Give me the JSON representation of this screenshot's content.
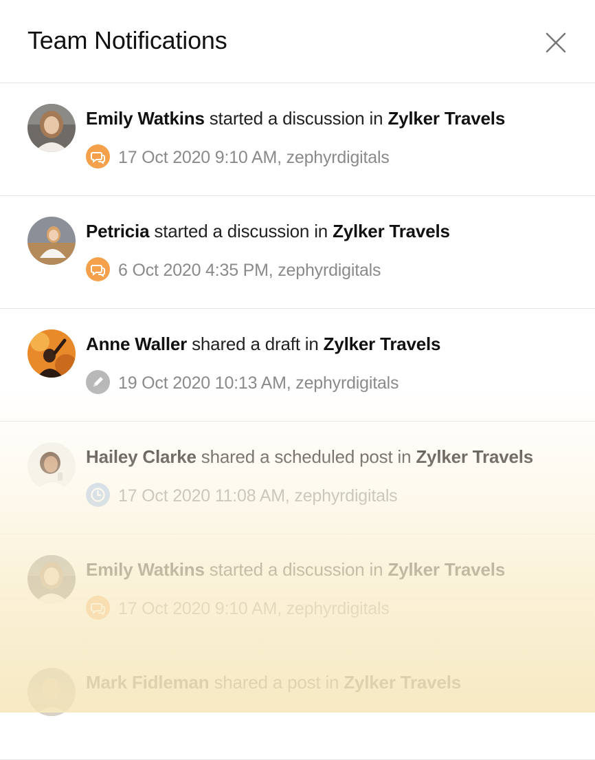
{
  "panel": {
    "title": "Team Notifications",
    "close_icon": "close-icon"
  },
  "notifications": [
    {
      "name": "Emily Watkins",
      "action": "started a discussion in",
      "target": "Zylker Travels",
      "time": "17 Oct 2020 9:10 AM, zephyrdigitals",
      "type_icon": "discussion-icon",
      "icon_color": "#f5a04a"
    },
    {
      "name": "Petricia",
      "action": "started a discussion in",
      "target": "Zylker Travels",
      "time": "6 Oct 2020 4:35 PM, zephyrdigitals",
      "type_icon": "discussion-icon",
      "icon_color": "#f5a04a"
    },
    {
      "name": "Anne Waller",
      "action": "shared a draft in",
      "target": "Zylker Travels",
      "time": "19 Oct 2020 10:13 AM, zephyrdigitals",
      "type_icon": "pencil-icon",
      "icon_color": "#b8b8b8"
    },
    {
      "name": "Hailey Clarke",
      "action": "shared a scheduled post in",
      "target": "Zylker Travels",
      "time": "17 Oct 2020 11:08 AM, zephyrdigitals",
      "type_icon": "clock-icon",
      "icon_color": "#a9c6ee"
    },
    {
      "name": "Emily Watkins",
      "action": "started a discussion in",
      "target": "Zylker Travels",
      "time": "17 Oct 2020 9:10 AM, zephyrdigitals",
      "type_icon": "discussion-icon",
      "icon_color": "#f5a04a"
    },
    {
      "name": "Mark Fidleman",
      "action": "shared a post in",
      "target": "Zylker Travels",
      "time": "",
      "type_icon": "",
      "icon_color": ""
    }
  ]
}
